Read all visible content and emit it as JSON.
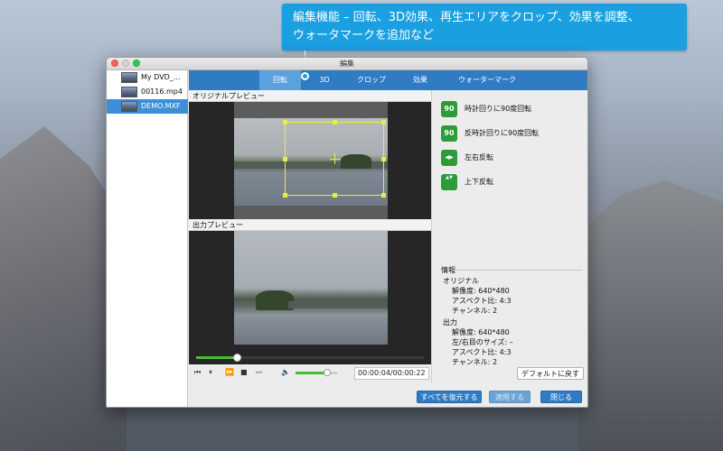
{
  "callout": {
    "line1": "編集機能 – 回転、3D効果、再生エリアをクロップ、効果を調整、",
    "line2": "ウォータマークを追加など"
  },
  "window": {
    "title": "編集"
  },
  "files": [
    {
      "name": "My DVD_..."
    },
    {
      "name": "00116.mp4"
    },
    {
      "name": "DEMO.MXF",
      "selected": true
    }
  ],
  "tabs": [
    {
      "label": "回転",
      "active": true
    },
    {
      "label": "3D"
    },
    {
      "label": "クロップ"
    },
    {
      "label": "効果"
    },
    {
      "label": "ウォーターマーク"
    }
  ],
  "preview": {
    "original_label": "オリジナルプレビュー",
    "output_label": "出力プレビュー"
  },
  "tools": [
    {
      "icon": "rotate-clockwise-icon",
      "glyph": "90",
      "label": "時計回りに90度回転"
    },
    {
      "icon": "rotate-counterclockwise-icon",
      "glyph": "90",
      "label": "反時計回りに90度回転"
    },
    {
      "icon": "flip-horizontal-icon",
      "glyph": "◀▶",
      "label": "左右反転"
    },
    {
      "icon": "flip-vertical-icon",
      "glyph": "▲▼",
      "label": "上下反転"
    }
  ],
  "info": {
    "title": "情報",
    "original_heading": "オリジナル",
    "original_resolution": "解像度: 640*480",
    "original_aspect": "アスペクト比: 4:3",
    "original_channel": "チャンネル: 2",
    "output_heading": "出力",
    "output_resolution": "解像度: 640*480",
    "output_lr_size": "左/右目のサイズ: –",
    "output_aspect": "アスペクト比: 4:3",
    "output_channel": "チャンネル: 2"
  },
  "playback": {
    "current_time": "00:00:04",
    "total_time": "00:00:22",
    "time_display": "00:00:04/00:00:22",
    "progress": 0.18,
    "volume": 0.75
  },
  "buttons": {
    "default": "デフォルトに戻す",
    "restore_all": "すべてを復元する",
    "apply": "適用する",
    "close": "閉じる"
  },
  "colors": {
    "accent": "#2f7bc4",
    "callout": "#1a9fe0",
    "tool_green": "#2f9a3a",
    "progress_green": "#4cbb34",
    "crop_yellow": "#e6ef3d"
  }
}
